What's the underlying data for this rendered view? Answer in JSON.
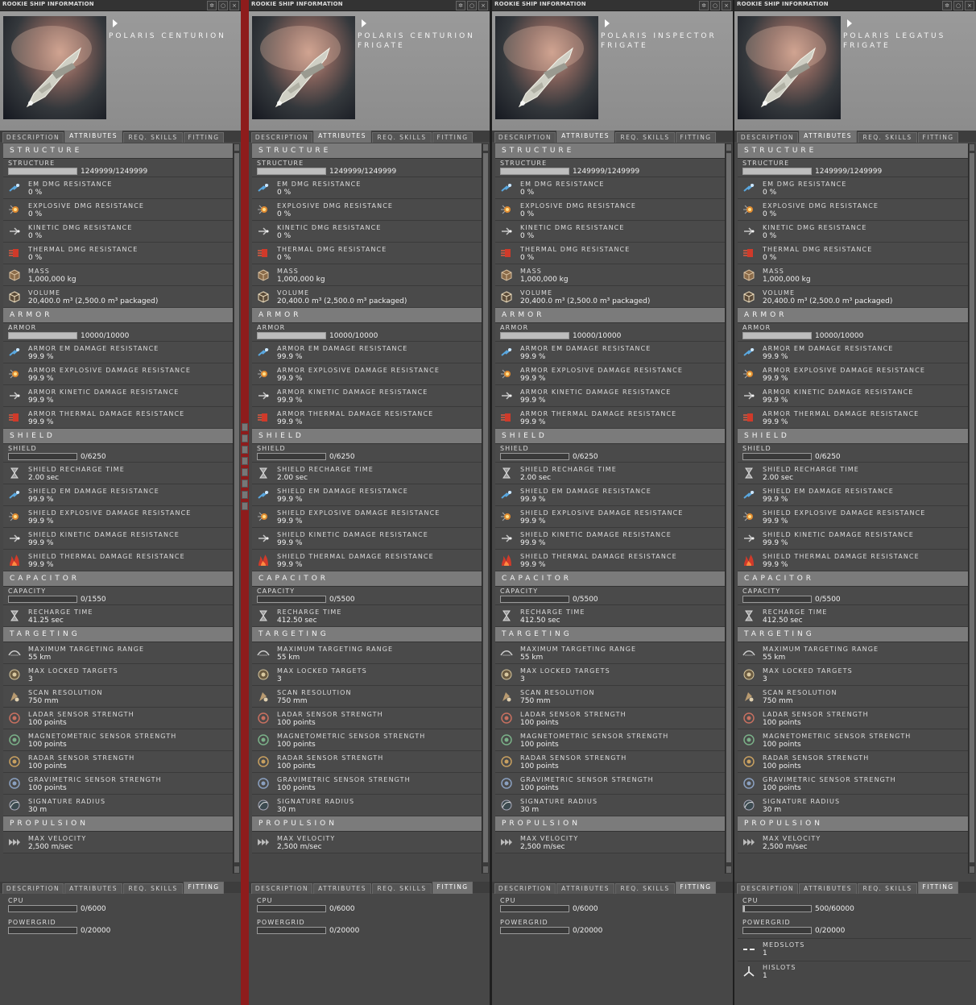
{
  "windows": [
    {
      "title": "ROOKIE SHIP INFORMATION",
      "ship_name": "POLARIS CENTURION",
      "tabs": [
        "DESCRIPTION",
        "ATTRIBUTES",
        "REQ. SKILLS",
        "FITTING"
      ],
      "active_tab": "ATTRIBUTES",
      "structure_fill": 1.0,
      "armor_fill": 1.0,
      "shield_fill": 0,
      "capacity": "0/1550",
      "capacitor_recharge": "41.25 sec",
      "capacity_fill": 0,
      "fitting": [
        {
          "label": "CPU",
          "value": "0/6000",
          "fill": 0
        },
        {
          "label": "POWERGRID",
          "value": "0/20000",
          "fill": 0
        }
      ],
      "slots": []
    },
    {
      "title": "ROOKIE SHIP INFORMATION",
      "ship_name": "POLARIS CENTURION FRIGATE",
      "tabs": [
        "DESCRIPTION",
        "ATTRIBUTES",
        "REQ. SKILLS",
        "FITTING"
      ],
      "active_tab": "ATTRIBUTES",
      "structure_fill": 1.0,
      "armor_fill": 1.0,
      "shield_fill": 0,
      "capacity": "0/5500",
      "capacitor_recharge": "412.50 sec",
      "capacity_fill": 0,
      "fitting": [
        {
          "label": "CPU",
          "value": "0/6000",
          "fill": 0
        },
        {
          "label": "POWERGRID",
          "value": "0/20000",
          "fill": 0
        }
      ],
      "slots": []
    },
    {
      "title": "ROOKIE SHIP INFORMATION",
      "ship_name": "POLARIS INSPECTOR FRIGATE",
      "tabs": [
        "DESCRIPTION",
        "ATTRIBUTES",
        "REQ. SKILLS",
        "FITTING"
      ],
      "active_tab": "ATTRIBUTES",
      "structure_fill": 1.0,
      "armor_fill": 1.0,
      "shield_fill": 0,
      "capacity": "0/5500",
      "capacitor_recharge": "412.50 sec",
      "capacity_fill": 0,
      "fitting": [
        {
          "label": "CPU",
          "value": "0/6000",
          "fill": 0
        },
        {
          "label": "POWERGRID",
          "value": "0/20000",
          "fill": 0
        }
      ],
      "slots": []
    },
    {
      "title": "ROOKIE SHIP INFORMATION",
      "ship_name": "POLARIS LEGATUS FRIGATE",
      "tabs": [
        "DESCRIPTION",
        "ATTRIBUTES",
        "REQ. SKILLS",
        "FITTING"
      ],
      "active_tab": "ATTRIBUTES",
      "structure_fill": 1.0,
      "armor_fill": 1.0,
      "shield_fill": 0,
      "capacity": "0/5500",
      "capacitor_recharge": "412.50 sec",
      "capacity_fill": 0,
      "fitting": [
        {
          "label": "CPU",
          "value": "500/60000",
          "fill": 0.01
        },
        {
          "label": "POWERGRID",
          "value": "0/20000",
          "fill": 0
        }
      ],
      "slots": [
        {
          "label": "MEDSLOTS",
          "value": "1",
          "icon": "medslot-icon"
        },
        {
          "label": "HISLOTS",
          "value": "1",
          "icon": "hislot-icon"
        }
      ]
    }
  ],
  "common": {
    "sections": {
      "structure": "STRUCTURE",
      "armor": "ARMOR",
      "shield": "SHIELD",
      "capacitor": "CAPACITOR",
      "targeting": "TARGETING",
      "propulsion": "PROPULSION"
    },
    "structure_bar": {
      "label": "STRUCTURE",
      "value": "1249999/1249999"
    },
    "structure_rows": [
      {
        "label": "EM DMG RESISTANCE",
        "value": "0 %",
        "icon": "em-icon"
      },
      {
        "label": "EXPLOSIVE DMG RESISTANCE",
        "value": "0 %",
        "icon": "explosive-icon"
      },
      {
        "label": "KINETIC DMG RESISTANCE",
        "value": "0 %",
        "icon": "kinetic-icon"
      },
      {
        "label": "THERMAL DMG RESISTANCE",
        "value": "0 %",
        "icon": "thermal-icon"
      },
      {
        "label": "MASS",
        "value": "1,000,000 kg",
        "icon": "mass-icon"
      },
      {
        "label": "VOLUME",
        "value": "20,400.0 m³ (2,500.0 m³ packaged)",
        "icon": "volume-icon"
      }
    ],
    "armor_bar": {
      "label": "ARMOR",
      "value": "10000/10000"
    },
    "armor_rows": [
      {
        "label": "ARMOR EM DAMAGE RESISTANCE",
        "value": "99.9 %",
        "icon": "em-icon"
      },
      {
        "label": "ARMOR EXPLOSIVE DAMAGE RESISTANCE",
        "value": "99.9 %",
        "icon": "explosive-icon"
      },
      {
        "label": "ARMOR KINETIC DAMAGE RESISTANCE",
        "value": "99.9 %",
        "icon": "kinetic-icon"
      },
      {
        "label": "ARMOR THERMAL DAMAGE RESISTANCE",
        "value": "99.9 %",
        "icon": "thermal-icon"
      }
    ],
    "shield_bar": {
      "label": "SHIELD",
      "value": "0/6250"
    },
    "shield_rows": [
      {
        "label": "SHIELD RECHARGE TIME",
        "value": "2.00 sec",
        "icon": "hourglass-icon"
      },
      {
        "label": "SHIELD EM DAMAGE RESISTANCE",
        "value": "99.9 %",
        "icon": "em-icon"
      },
      {
        "label": "SHIELD EXPLOSIVE DAMAGE RESISTANCE",
        "value": "99.9 %",
        "icon": "explosive-icon"
      },
      {
        "label": "SHIELD KINETIC DAMAGE RESISTANCE",
        "value": "99.9 %",
        "icon": "kinetic-icon"
      },
      {
        "label": "SHIELD THERMAL DAMAGE RESISTANCE",
        "value": "99.9 %",
        "icon": "flame-icon"
      }
    ],
    "capacity_label": "CAPACITY",
    "recharge_label": "RECHARGE TIME",
    "targeting_rows": [
      {
        "label": "MAXIMUM TARGETING RANGE",
        "value": "55 km",
        "icon": "range-icon"
      },
      {
        "label": "MAX  LOCKED TARGETS",
        "value": "3",
        "icon": "locked-targets-icon"
      },
      {
        "label": "SCAN RESOLUTION",
        "value": "750 mm",
        "icon": "scan-icon"
      },
      {
        "label": "LADAR SENSOR STRENGTH",
        "value": "100 points",
        "icon": "ladar-icon"
      },
      {
        "label": "MAGNETOMETRIC SENSOR STRENGTH",
        "value": "100 points",
        "icon": "magnetometric-icon"
      },
      {
        "label": "RADAR SENSOR STRENGTH",
        "value": "100 points",
        "icon": "radar-icon"
      },
      {
        "label": "GRAVIMETRIC SENSOR STRENGTH",
        "value": "100 points",
        "icon": "gravimetric-icon"
      },
      {
        "label": "SIGNATURE RADIUS",
        "value": "30 m",
        "icon": "signature-icon"
      }
    ],
    "propulsion_rows": [
      {
        "label": "MAX VELOCITY",
        "value": "2,500 m/sec",
        "icon": "velocity-icon"
      }
    ],
    "fitting_tabs": [
      "DESCRIPTION",
      "ATTRIBUTES",
      "REQ. SKILLS",
      "FITTING"
    ],
    "fitting_active_tab": "FITTING",
    "colors": {
      "em": "#5aa8e0",
      "explosive": "#e08a30",
      "kinetic": "#c8c8c8",
      "thermal": "#d03a2a",
      "separator_red": "#8e1c1c"
    }
  }
}
